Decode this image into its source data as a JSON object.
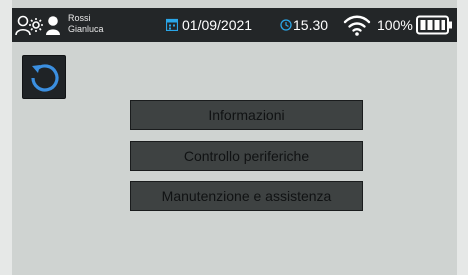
{
  "status_bar": {
    "user_line1": "Rossi",
    "user_line2": "Gianluca",
    "date": "01/09/2021",
    "time": "15.30",
    "battery_percent": "100%",
    "battery_level": 1.0
  },
  "menu": {
    "items": [
      {
        "label": "Informazioni"
      },
      {
        "label": "Controllo periferiche"
      },
      {
        "label": "Manutenzione e assistenza"
      }
    ]
  },
  "colors": {
    "background": "#cfd3d1",
    "status_bar": "#232628",
    "button_fill": "#3e4242",
    "back_icon": "#3b8fe0"
  },
  "icons": {
    "users": "users-settings-icon",
    "calendar": "calendar-icon",
    "clock": "clock-icon",
    "wifi": "wifi-icon",
    "battery": "battery-icon",
    "back": "back-refresh-icon"
  }
}
